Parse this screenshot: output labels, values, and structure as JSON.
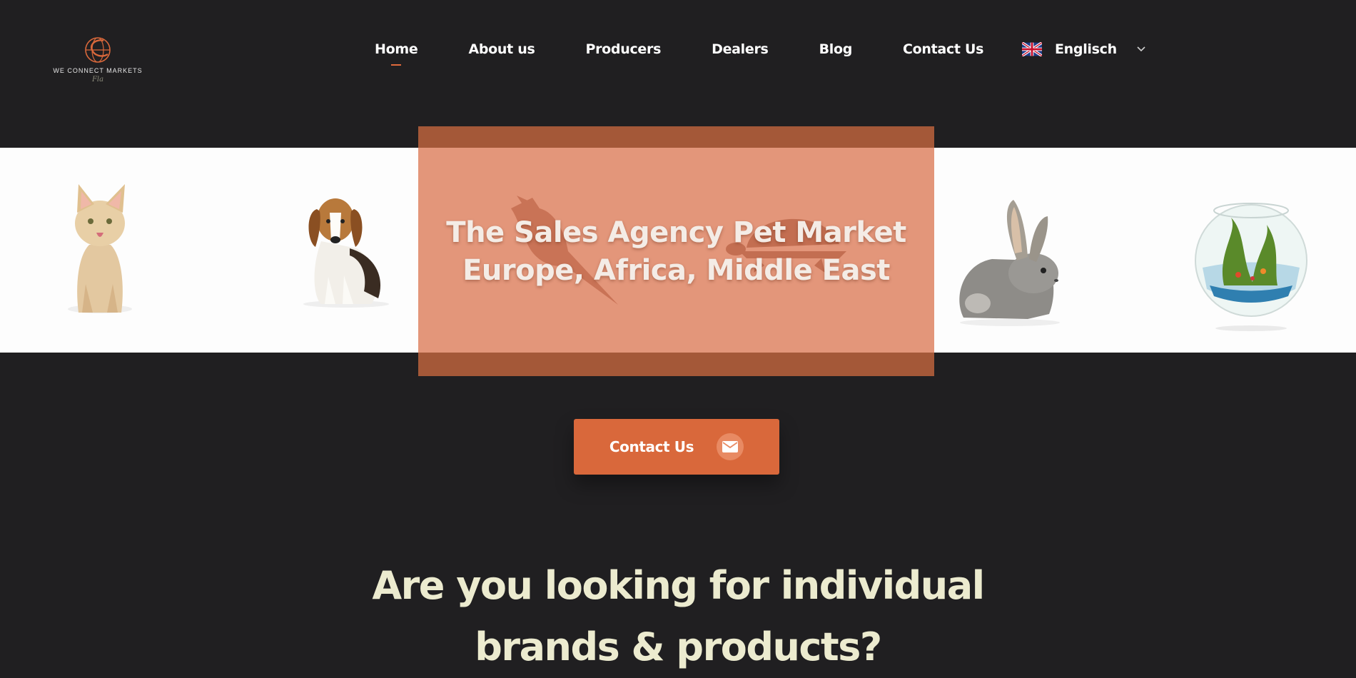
{
  "logo": {
    "text": "WE CONNECT MARKETS",
    "signature": "Fla",
    "accent": "#d9683b"
  },
  "nav": {
    "items": [
      {
        "label": "Home",
        "active": true
      },
      {
        "label": "About us"
      },
      {
        "label": "Producers"
      },
      {
        "label": "Dealers"
      },
      {
        "label": "Blog"
      },
      {
        "label": "Contact Us"
      }
    ]
  },
  "language": {
    "label": "Englisch",
    "flag": "uk-flag-icon"
  },
  "hero": {
    "title_line1": "The Sales Agency Pet Market",
    "title_line2": "Europe, Africa, Middle East",
    "animals": [
      "kitten-image",
      "beagle-image",
      "bird-image",
      "turtle-image",
      "rabbit-image",
      "fishbowl-image"
    ]
  },
  "cta": {
    "label": "Contact Us",
    "icon": "envelope-icon"
  },
  "headline": {
    "line1": "Are you looking for individual",
    "line2": "brands & products?"
  },
  "colors": {
    "background": "#201f21",
    "accent": "#d9683b",
    "hero_panel": "#e3967a",
    "hero_frame": "#a45838",
    "headline": "#ecebcf"
  }
}
